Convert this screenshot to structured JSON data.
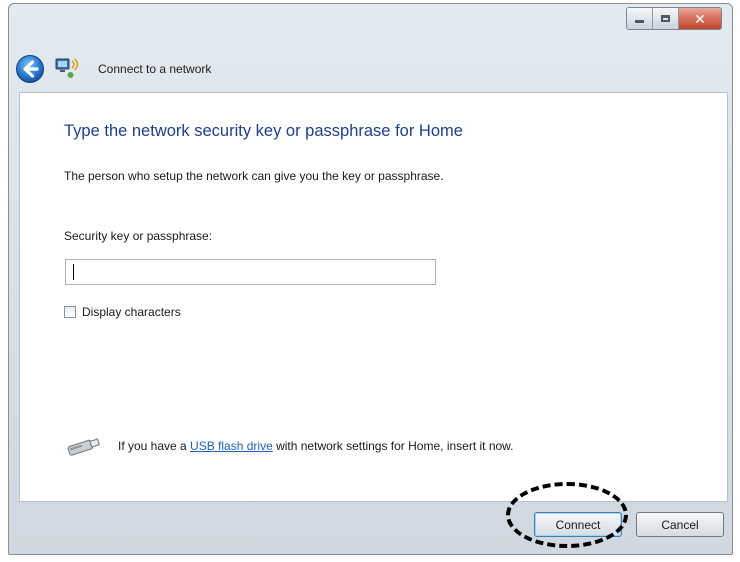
{
  "window": {
    "caption_buttons": [
      "minimize-icon",
      "maximize-icon",
      "close-icon"
    ]
  },
  "nav": {
    "back_icon": "back-arrow-icon",
    "app_icon": "network-icon",
    "title": "Connect to a network"
  },
  "content": {
    "heading": "Type the network security key or passphrase for Home",
    "subtext": "The person who setup the network can give you the key or passphrase.",
    "field_label": "Security key or passphrase:",
    "key_value": "",
    "display_characters_label": "Display characters",
    "display_characters_checked": false,
    "usb": {
      "icon": "usb-drive-icon",
      "text_before": "If you have a ",
      "link_text": "USB flash drive",
      "text_after": " with network settings for Home, insert it now."
    }
  },
  "buttons": {
    "connect": "Connect",
    "cancel": "Cancel"
  },
  "colors": {
    "heading": "#1e3f8a",
    "link": "#1f5fbf",
    "close_button": "#c2452c"
  }
}
